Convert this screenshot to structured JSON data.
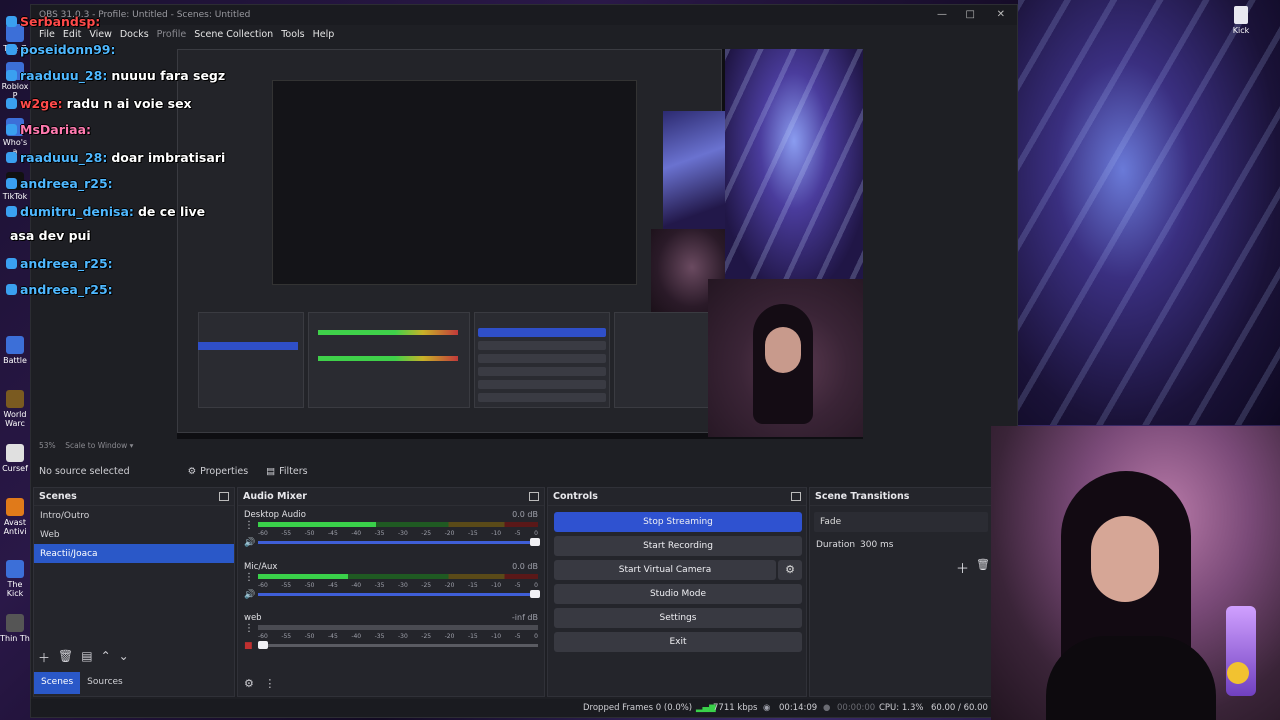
{
  "window": {
    "title": "OBS 31.0.3 - Profile: Untitled - Scenes: Untitled",
    "controls": [
      "—",
      "□",
      "✕"
    ]
  },
  "menu": [
    "File",
    "Edit",
    "View",
    "Docks",
    "Profile",
    "Scene Collection",
    "Tools",
    "Help"
  ],
  "desktop": {
    "right_icon_label": "Kick",
    "left_icons": [
      "The G",
      "Roblox P",
      "Who's a",
      "TikTok",
      "Battle",
      "World Warc",
      "Cursef",
      "Avast Antivi",
      "The Kick",
      "Thin Th"
    ]
  },
  "chat": [
    {
      "user": "Serbandsp:",
      "msg": "",
      "user_color": "#ff4a4a"
    },
    {
      "user": "poseidonn99:",
      "msg": "",
      "user_color": "#4fb8ff"
    },
    {
      "user": "raaduuu_28:",
      "msg": "nuuuu fara segz",
      "user_color": "#4fb8ff"
    },
    {
      "user": "w2ge:",
      "msg": "radu n ai voie sex",
      "user_color": "#ff4a4a"
    },
    {
      "user": "MsDariaa:",
      "msg": "",
      "user_color": "#ff7ab0"
    },
    {
      "user": "raaduuu_28:",
      "msg": "doar imbratisari",
      "user_color": "#4fb8ff"
    },
    {
      "user": "andreea_r25:",
      "msg": "",
      "user_color": "#4fb8ff"
    },
    {
      "user": "dumitru_denisa:",
      "msg": "de ce live",
      "user_color": "#4fb8ff"
    },
    {
      "user": "",
      "msg": "asa dev pui",
      "user_color": "#ffffff"
    },
    {
      "user": "andreea_r25:",
      "msg": "",
      "user_color": "#4fb8ff"
    },
    {
      "user": "andreea_r25:",
      "msg": "",
      "user_color": "#4fb8ff"
    }
  ],
  "preview": {
    "zoom_label": "53%",
    "scale_label": "Scale to Window"
  },
  "toolbar": {
    "selection": "No source selected",
    "properties": "Properties",
    "filters": "Filters"
  },
  "scenes": {
    "title": "Scenes",
    "items": [
      "Intro/Outro",
      "Web",
      "Reactii/Joaca"
    ],
    "selected_index": 2,
    "tabs": [
      "Scenes",
      "Sources"
    ]
  },
  "mixer": {
    "title": "Audio Mixer",
    "channels": [
      {
        "name": "Desktop Audio",
        "db": "0.0 dB",
        "level": 0.42,
        "muted": false
      },
      {
        "name": "Mic/Aux",
        "db": "0.0 dB",
        "level": 0.32,
        "muted": false
      },
      {
        "name": "web",
        "db": "-inf dB",
        "level": 0.0,
        "muted": true
      }
    ],
    "ticks": [
      "-60",
      "-55",
      "-50",
      "-45",
      "-40",
      "-35",
      "-30",
      "-25",
      "-20",
      "-15",
      "-10",
      "-5",
      "0"
    ]
  },
  "controls": {
    "title": "Controls",
    "buttons": [
      "Stop Streaming",
      "Start Recording",
      "Start Virtual Camera",
      "Studio Mode",
      "Settings",
      "Exit"
    ]
  },
  "transitions": {
    "title": "Scene Transitions",
    "selected": "Fade",
    "duration_label": "Duration",
    "duration_value": "300 ms"
  },
  "status": {
    "dropped": "Dropped Frames 0 (0.0%)",
    "bitrate": "7711 kbps",
    "stream_time": "00:14:09",
    "rec_time": "00:00:00",
    "cpu": "CPU: 1.3%",
    "fps": "60.00 / 60.00 FPS"
  },
  "colors": {
    "accent": "#2a58c8",
    "meter_green": "#3ad14a",
    "mute_red": "#c03030"
  }
}
